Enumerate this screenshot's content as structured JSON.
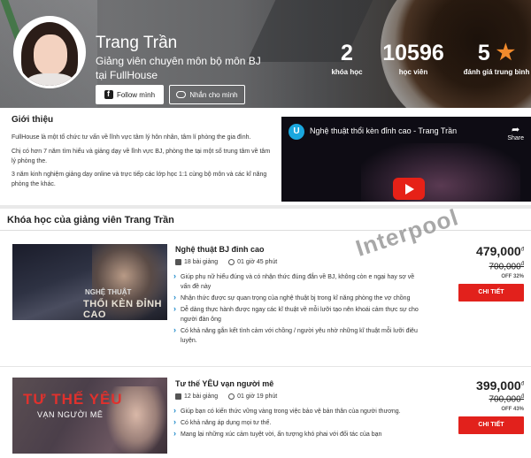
{
  "profile": {
    "name": "Trang Trần",
    "bio": "Giảng viên chuyên môn bộ môn BJ tại FullHouse",
    "follow_label": "Follow mình",
    "message_label": "Nhắn cho mình"
  },
  "stats": [
    {
      "value": "2",
      "label": "khóa học"
    },
    {
      "value": "10596",
      "label": "học viên"
    },
    {
      "value": "5",
      "label": "đánh giá trung bình"
    }
  ],
  "intro": {
    "heading": "Giới thiệu",
    "p1": "FullHouse là một tổ chức tư vấn về lĩnh vực tâm lý hôn nhân, tâm lí phòng the gia đình.",
    "p2": "Chị có hơn 7 năm tìm hiểu và giảng dạy về lĩnh vực BJ, phòng the tại một số trung tâm về tâm lý phòng the.",
    "p3": "3 năm kinh nghiệm giảng dạy online và trực tiếp các lớp học 1:1 cùng bộ môn và các kĩ năng phòng the khác."
  },
  "video": {
    "title": "Nghệ thuật thổi kèn đỉnh cao - Trang Trần",
    "share_label": "Share",
    "logo_letter": "U"
  },
  "courses_heading": "Khóa học của giảng viên Trang Trần",
  "watermark": "Interpool",
  "courses": [
    {
      "title": "Nghệ thuật BJ đỉnh cao",
      "lessons": "18 bài giảng",
      "duration": "01 giờ 45 phút",
      "thumb_line1": "NGHỆ THUẬT",
      "thumb_line2": "THỔI KÈN ĐỈNH CAO",
      "bullets": [
        "Giúp phụ nữ hiểu đúng và có nhận thức đúng đắn về BJ, không còn e ngại hay sợ về vấn đề này",
        "Nhận thức được sự quan trọng của nghệ thuật bj trong kĩ năng phòng the vợ chồng",
        "Dễ dàng thực hành được ngay các kĩ thuật về mỗi lưỡi tạo nên khoái cảm thực sự cho người đàn ông",
        "Có khả năng gắn kết tình cảm với chồng / người yêu nhờ những kĩ thuật mỗi lưỡi điêu luyện."
      ],
      "price": "479,000",
      "currency": "đ",
      "old_price": "700,000",
      "discount": "OFF 32%",
      "button": "CHI TIẾT"
    },
    {
      "title": "Tư thế YÊU vạn người mê",
      "lessons": "12 bài giảng",
      "duration": "01 giờ 19 phút",
      "thumb_line1": "TƯ THẾ YÊU",
      "thumb_line2": "VẠN NGƯỜI MÊ",
      "bullets": [
        "Giúp bạn có kiến thức vững vàng trong việc bảo vệ bản thân của người thương.",
        "Có khả năng áp dụng mọi tư thế.",
        "Mang lại những xúc cảm tuyệt vời, ấn tượng khó phai với đối tác của bạn"
      ],
      "price": "399,000",
      "currency": "đ",
      "old_price": "700,000",
      "discount": "OFF 43%",
      "button": "CHI TIẾT"
    }
  ]
}
